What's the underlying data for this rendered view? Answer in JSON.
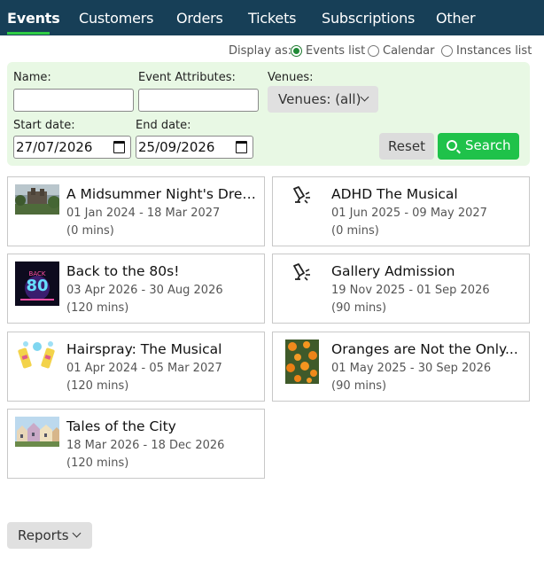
{
  "nav": {
    "tabs": [
      {
        "label": "Events",
        "active": true
      },
      {
        "label": "Customers",
        "active": false
      },
      {
        "label": "Orders",
        "active": false
      },
      {
        "label": "Tickets",
        "active": false
      },
      {
        "label": "Subscriptions",
        "active": false
      },
      {
        "label": "Other",
        "active": false
      }
    ]
  },
  "display_as": {
    "label": "Display as:",
    "options": [
      {
        "label": "Events list",
        "selected": true
      },
      {
        "label": "Calendar",
        "selected": false
      },
      {
        "label": "Instances list",
        "selected": false
      }
    ]
  },
  "filters": {
    "name_label": "Name:",
    "name_value": "",
    "attributes_label": "Event Attributes:",
    "attributes_value": "",
    "venues_label": "Venues:",
    "venues_value": "Venues: (all)",
    "start_label": "Start date:",
    "start_value": "27/07/2026",
    "end_label": "End date:",
    "end_value": "25/09/2026",
    "reset_label": "Reset",
    "search_label": "Search"
  },
  "events": [
    {
      "title": "A Midsummer Night's Dream",
      "dates": "01 Jan 2024 - 18 Mar 2027",
      "duration": "(0 mins)",
      "icon": "image-castle"
    },
    {
      "title": "ADHD The Musical",
      "dates": "01 Jun 2025 - 09 May 2027",
      "duration": "(0 mins)",
      "icon": "spotlight-icon"
    },
    {
      "title": "Back to the 80s!",
      "dates": "03 Apr 2026 - 30 Aug 2026",
      "duration": "(120 mins)",
      "icon": "image-80s"
    },
    {
      "title": "Gallery Admission",
      "dates": "19 Nov 2025 - 01 Sep 2026",
      "duration": "(90 mins)",
      "icon": "spotlight-icon"
    },
    {
      "title": "Hairspray: The Musical",
      "dates": "01 Apr 2024 - 05 Mar 2027",
      "duration": "(120 mins)",
      "icon": "image-hairspray"
    },
    {
      "title": "Oranges are Not the Only...",
      "dates": "01 May 2025 - 30 Sep 2026",
      "duration": "(90 mins)",
      "icon": "image-oranges"
    },
    {
      "title": "Tales of the City",
      "dates": "18 Mar 2026 - 18 Dec 2026",
      "duration": "(120 mins)",
      "icon": "image-houses"
    }
  ],
  "reports": {
    "label": "Reports"
  },
  "colors": {
    "nav_bg": "#173f57",
    "accent": "#2fcc45",
    "search_btn": "#1fc24a",
    "filter_bg": "#e8f8e4"
  }
}
